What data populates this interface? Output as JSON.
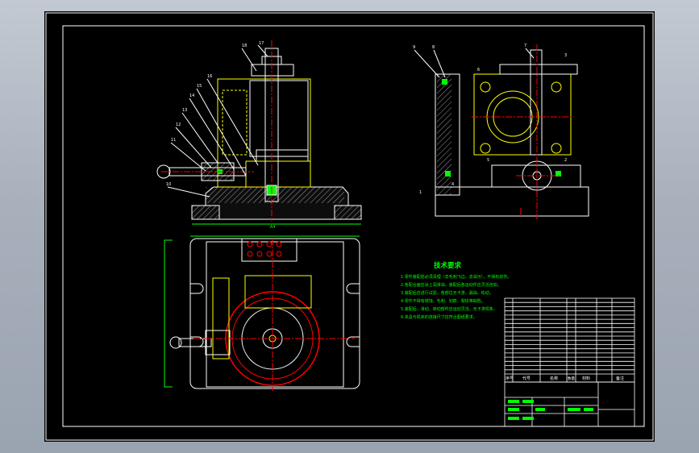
{
  "drawing": {
    "tech_requirements": {
      "title": "技术要求",
      "lines": [
        "1.零件装配前必须清理（去毛刺飞边、去油污），不得有划伤。",
        "2.各配合面应涂上润滑油，装配后各运动件应灵活自如。",
        "3.装配后应进行试验，各部位无卡滞、漏油、松动。",
        "4.零件不得有锈蚀、毛刺、划痕、裂纹等缺陷。",
        "5.装配后，滑动、转动部件应运动灵活，无卡滞现象。",
        "6.夹具与机床的连接尺寸应符合图纸要求。"
      ]
    },
    "bom_header": {
      "seq": "序号",
      "code": "代号",
      "name": "名称",
      "qty": "数量",
      "material": "材料",
      "note": "备注"
    },
    "balloon_labels": [
      "18",
      "17",
      "16",
      "15",
      "14",
      "13",
      "12",
      "11",
      "10",
      "9",
      "8",
      "7",
      "6",
      "5",
      "4",
      "3",
      "2",
      "1"
    ],
    "dim_label": "A4"
  }
}
